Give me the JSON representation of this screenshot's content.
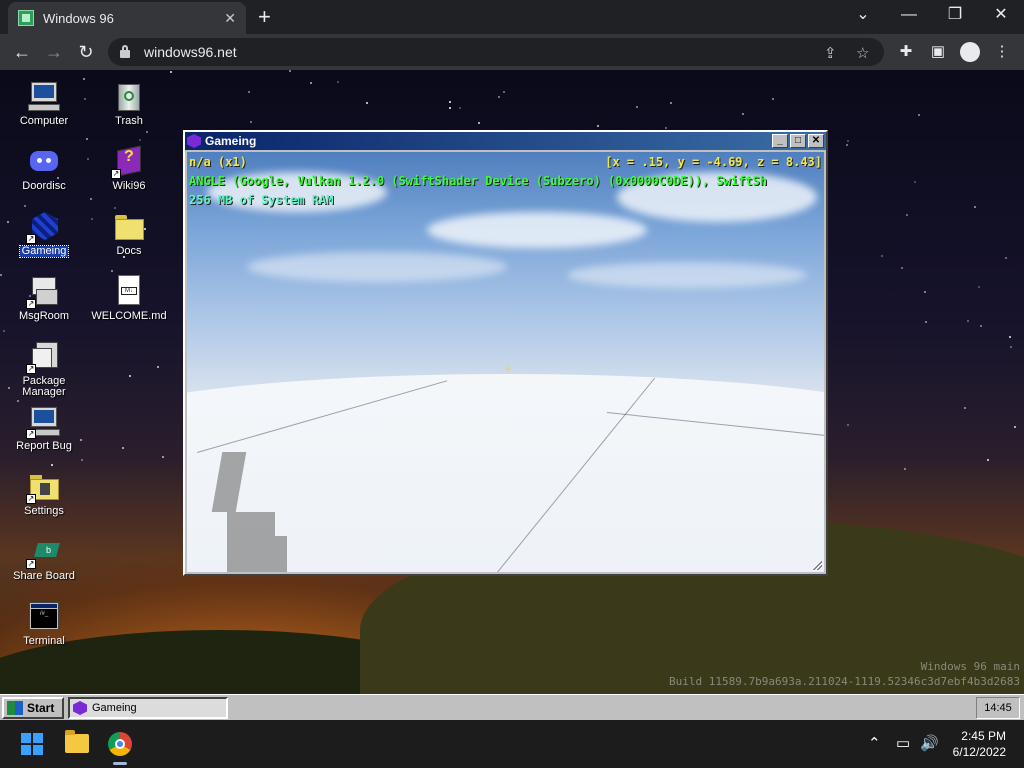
{
  "browser": {
    "tab_title": "Windows 96",
    "tab_close": "✕",
    "new_tab": "+",
    "url": "windows96.net",
    "window_controls": {
      "minimize": "⌄",
      "restore": "—",
      "maximize": "❐",
      "close": "✕"
    },
    "nav": {
      "back": "←",
      "forward": "→",
      "reload": "↻"
    },
    "icons": {
      "share": "⇪",
      "bookmark": "☆",
      "extensions": "✚",
      "sidepanel": "▣",
      "menu": "⋮"
    }
  },
  "desktop": {
    "icons": [
      {
        "label": "Computer",
        "icon": "computer-icon"
      },
      {
        "label": "Trash",
        "icon": "trash-icon"
      },
      {
        "label": "Doordisc",
        "icon": "doordisc-icon"
      },
      {
        "label": "Wiki96",
        "icon": "wiki96-icon"
      },
      {
        "label": "Gameing",
        "icon": "gameing-icon",
        "selected": true
      },
      {
        "label": "Docs",
        "icon": "folder-icon"
      },
      {
        "label": "MsgRoom",
        "icon": "msgroom-icon"
      },
      {
        "label": "WELCOME.md",
        "icon": "markdown-file-icon"
      },
      {
        "label": "Package Manager",
        "icon": "package-manager-icon"
      },
      {
        "label": "Report Bug",
        "icon": "report-bug-icon"
      },
      {
        "label": "Settings",
        "icon": "settings-icon"
      },
      {
        "label": "Share Board",
        "icon": "share-board-icon"
      },
      {
        "label": "Terminal",
        "icon": "terminal-icon"
      }
    ],
    "watermark_line1": "Windows 96 main",
    "watermark_line2": "Build 11589.7b9a693a.211024-1119.52346c3d7ebf4b3d2683"
  },
  "window": {
    "title": "Gameing",
    "buttons": {
      "minimize": "_",
      "maximize": "□",
      "close": "✕"
    },
    "hud": {
      "fps": "n/a (x1)",
      "coords": "[x = .15, y = -4.69, z = 8.43]",
      "renderer": "ANGLE (Google, Vulkan 1.2.0 (SwiftShader Device (Subzero) (0x0000C0DE)), SwiftSh",
      "memory": "256 MB of System RAM"
    }
  },
  "taskbar96": {
    "start_label": "Start",
    "task_label": "Gameing",
    "clock": "14:45"
  },
  "taskbar11": {
    "tray_icons": {
      "chevron": "⌃",
      "network": "▭",
      "volume": "🔊"
    },
    "time": "2:45 PM",
    "date": "6/12/2022"
  },
  "colors": {
    "titlebar_start": "#0a246a",
    "titlebar_end": "#3a6ea5",
    "hud_yellow": "#f2e84a",
    "hud_green": "#3dfb3d",
    "hud_cyan": "#5ff5c4"
  }
}
